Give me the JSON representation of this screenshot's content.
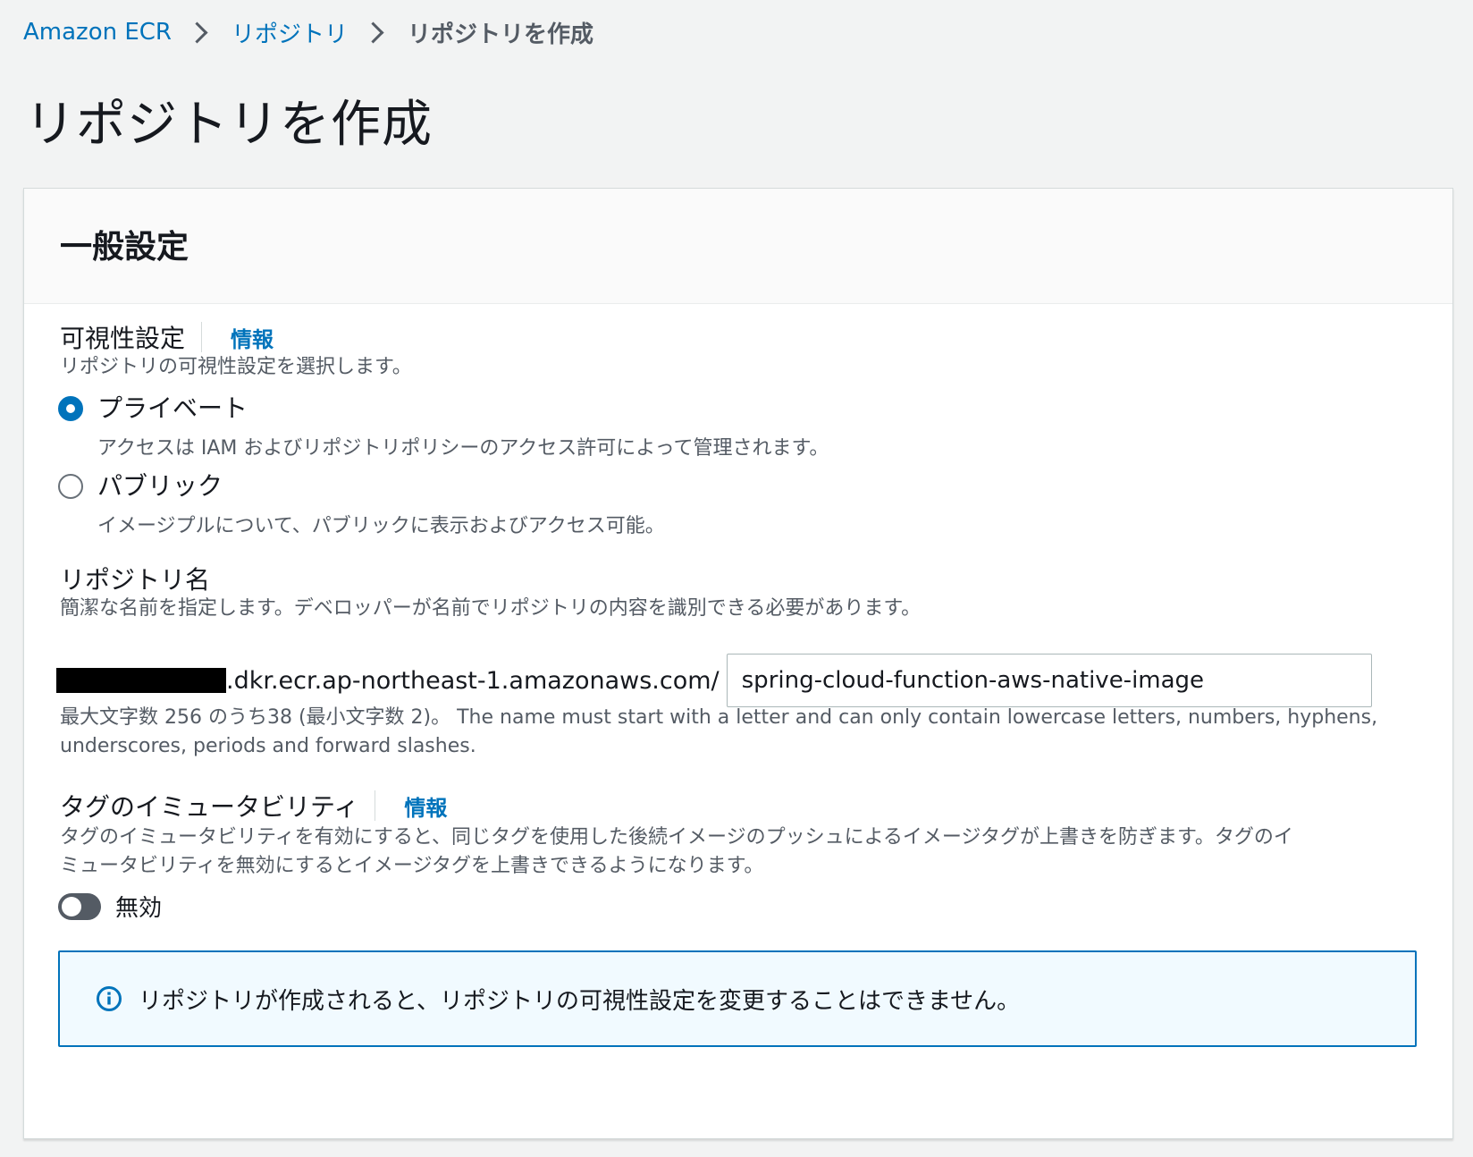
{
  "breadcrumb": {
    "items": [
      "Amazon ECR",
      "リポジトリ"
    ],
    "current": "リポジトリを作成"
  },
  "page": {
    "title": "リポジトリを作成"
  },
  "general": {
    "title": "一般設定",
    "visibility": {
      "label": "可視性設定",
      "info": "情報",
      "description": "リポジトリの可視性設定を選択します。",
      "options": [
        {
          "label": "プライベート",
          "description": "アクセスは IAM およびリポジトリポリシーのアクセス許可によって管理されます。",
          "selected": true
        },
        {
          "label": "パブリック",
          "description": "イメージプルについて、パブリックに表示およびアクセス可能。",
          "selected": false
        }
      ]
    },
    "repo_name": {
      "label": "リポジトリ名",
      "description": "簡潔な名前を指定します。デベロッパーが名前でリポジトリの内容を識別できる必要があります。",
      "uri_suffix": ".dkr.ecr.ap-northeast-1.amazonaws.com/",
      "value": "spring-cloud-function-aws-native-image",
      "constraint_line1": "最大文字数 256 のうち38 (最小文字数 2)。 The name must start with a letter and can only contain lowercase letters, numbers, hyphens,",
      "constraint_line2": "underscores, periods and forward slashes."
    },
    "tag_immutability": {
      "label": "タグのイミュータビリティ",
      "info": "情報",
      "description_line1": "タグのイミュータビリティを有効にすると、同じタグを使用した後続イメージのプッシュによるイメージタグが上書きを防ぎます。タグのイ",
      "description_line2": "ミュータビリティを無効にするとイメージタグを上書きできるようになります。",
      "toggle_label": "無効",
      "enabled": false
    },
    "alert": {
      "icon": "info-circle-icon",
      "text": "リポジトリが作成されると、リポジトリの可視性設定を変更することはできません。"
    }
  },
  "colors": {
    "link": "#0073bb",
    "text": "#16191f",
    "secondary_text": "#545b64",
    "background": "#f2f3f3",
    "alert_border": "#0073bb",
    "alert_background": "#f1faff"
  }
}
